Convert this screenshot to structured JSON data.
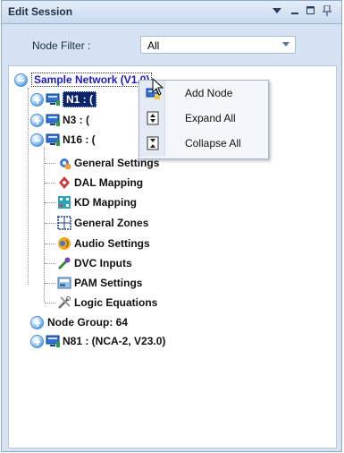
{
  "window": {
    "title": "Edit Session",
    "buttons": [
      "dropdown",
      "minimize",
      "maximize",
      "pin"
    ]
  },
  "filter": {
    "label": "Node Filter :",
    "value": "All"
  },
  "tree": {
    "root": "Sample Network (V1.0)",
    "nodes": [
      {
        "label": "N1 : (",
        "state": "collapsed",
        "selected": true
      },
      {
        "label": "N3 : (",
        "state": "collapsed"
      },
      {
        "label": "N16 : (",
        "state": "expanded"
      }
    ],
    "n16_children": [
      {
        "label": "General Settings",
        "icon": "gear-icon"
      },
      {
        "label": "DAL Mapping",
        "icon": "map-pin-icon"
      },
      {
        "label": "KD Mapping",
        "icon": "keypad-icon"
      },
      {
        "label": "General Zones",
        "icon": "zones-icon"
      },
      {
        "label": "Audio Settings",
        "icon": "audio-icon"
      },
      {
        "label": "DVC Inputs",
        "icon": "microphone-icon"
      },
      {
        "label": "PAM Settings",
        "icon": "pam-icon"
      },
      {
        "label": "Logic Equations",
        "icon": "tools-icon"
      }
    ],
    "node_group": "Node Group: 64",
    "n81": "N81 : (NCA-2, V23.0)"
  },
  "context_menu": {
    "items": [
      {
        "label": "Add Node",
        "icon": "add-node-icon"
      },
      {
        "label": "Expand All",
        "icon": "expand-all-icon"
      },
      {
        "label": "Collapse All",
        "icon": "collapse-all-icon"
      }
    ]
  },
  "colors": {
    "panel_bg": "#d6e3f2",
    "selection": "#0a246a",
    "root_text": "#1a1ac8",
    "expander": "#4d8fd6"
  }
}
